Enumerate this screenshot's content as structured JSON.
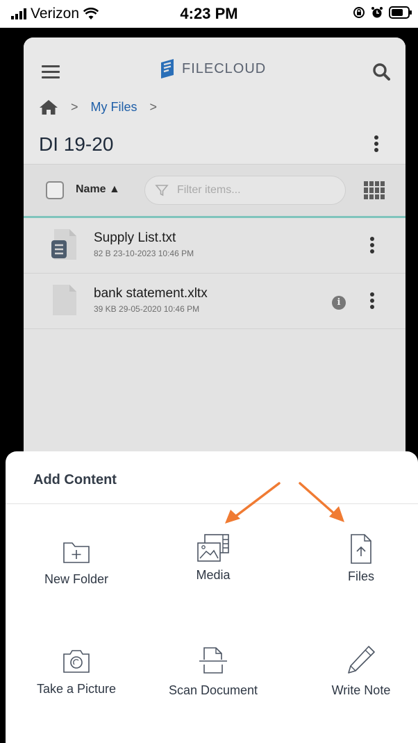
{
  "status_bar": {
    "carrier": "Verizon",
    "time": "4:23 PM"
  },
  "app": {
    "logo_text": "FILECLOUD",
    "breadcrumb": {
      "current": "My Files"
    },
    "folder_title": "DI 19-20",
    "toolbar": {
      "sort_label": "Name ▲",
      "filter_placeholder": "Filter items..."
    },
    "files": [
      {
        "name": "Supply List.txt",
        "meta": "82 B 23-10-2023 10:46 PM",
        "icon": "text-file-icon"
      },
      {
        "name": "bank statement.xltx",
        "meta": "39 KB 29-05-2020 10:46 PM",
        "icon": "blank-file-icon"
      }
    ]
  },
  "add_content": {
    "title": "Add Content",
    "options": [
      {
        "label": "New Folder",
        "icon": "new-folder-icon"
      },
      {
        "label": "Media",
        "icon": "media-icon"
      },
      {
        "label": "Files",
        "icon": "file-upload-icon"
      },
      {
        "label": "Take a Picture",
        "icon": "camera-icon"
      },
      {
        "label": "Scan Document",
        "icon": "scan-document-icon"
      },
      {
        "label": "Write Note",
        "icon": "pencil-icon"
      }
    ]
  },
  "colors": {
    "accent_link": "#1f5fa8",
    "annotation_arrow": "#f07b33",
    "toolbar_underline": "#7fc4bc"
  }
}
